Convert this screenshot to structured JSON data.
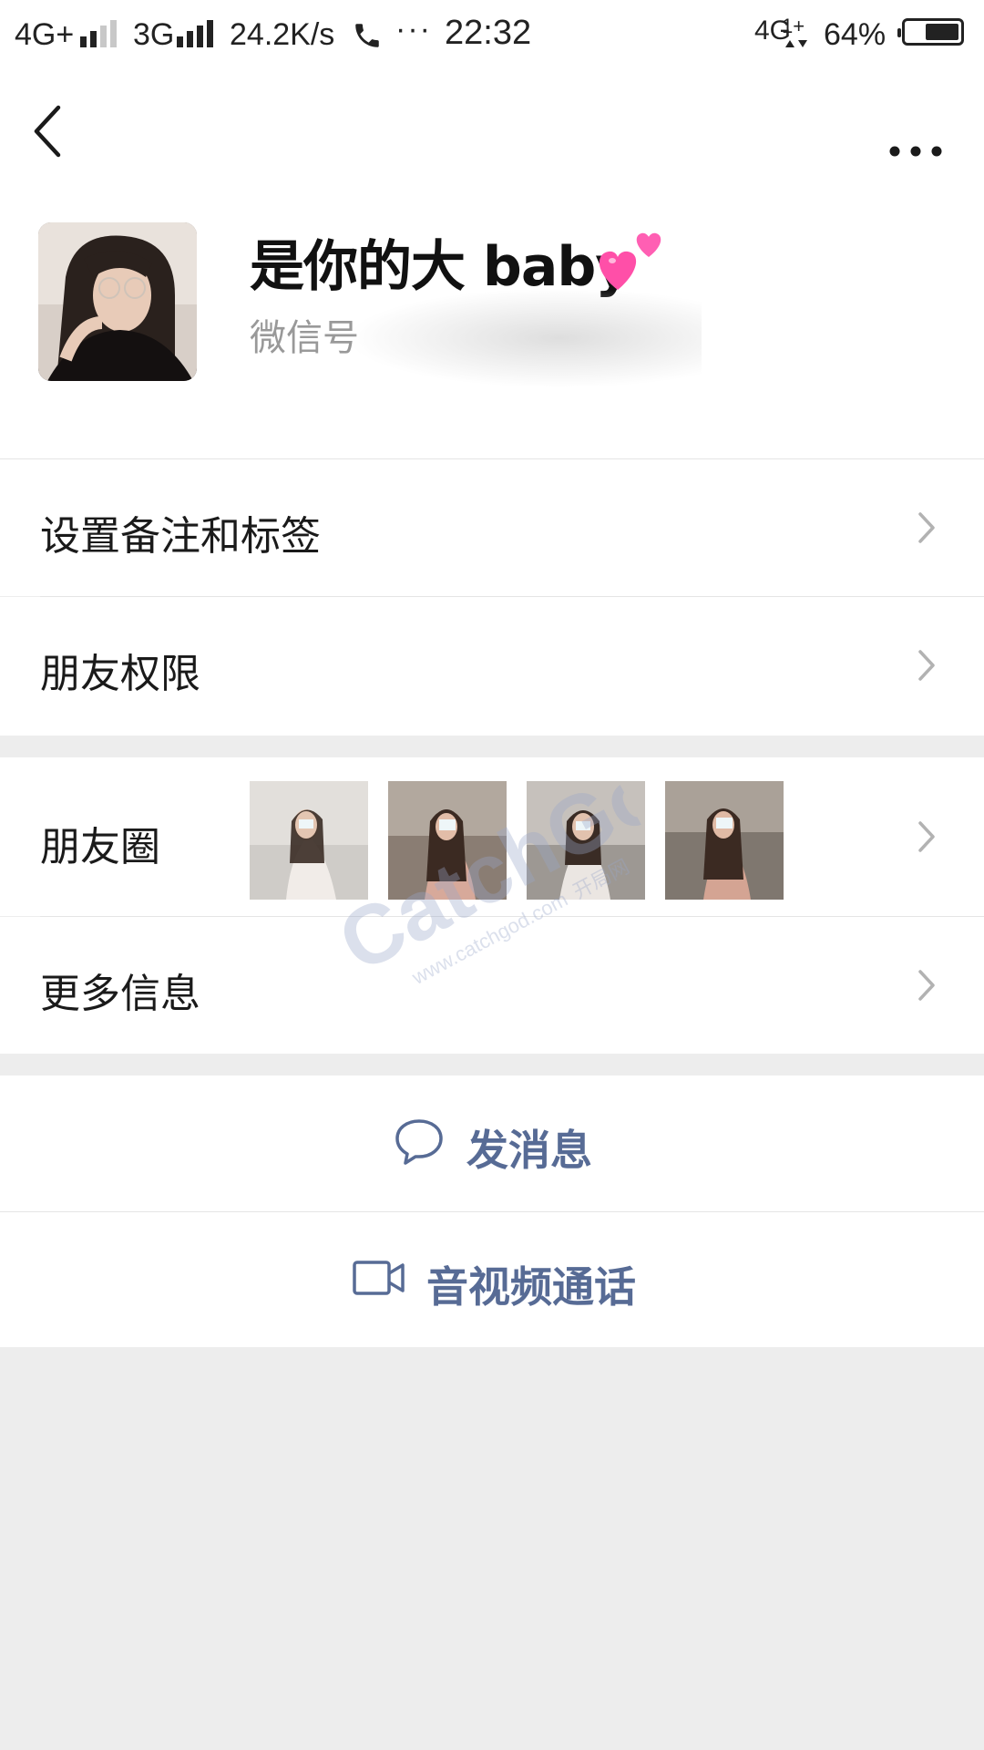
{
  "status_bar": {
    "network1": "4G+",
    "network2": "3G",
    "speed": "24.2K/s",
    "more_glyph": "···",
    "time": "22:32",
    "right_network": "4G",
    "battery_percent": "64%",
    "battery_level": 0.64
  },
  "header": {
    "back_icon": "back-chevron-icon",
    "more_icon": "more-dots-icon"
  },
  "profile": {
    "nickname": "是你的大 baby",
    "wechat_id_label": "微信号"
  },
  "menu": {
    "remarks_tags": "设置备注和标签",
    "friend_permissions": "朋友权限",
    "moments": "朋友圈",
    "more_info": "更多信息"
  },
  "actions": {
    "send_message": "发消息",
    "voice_video_call": "音视频通话"
  },
  "watermark": {
    "brand": "CatchGod",
    "url": "www.catchgod.com",
    "cn": "开局网"
  },
  "colors": {
    "accent": "#576b95",
    "background": "#ededed",
    "cell": "#ffffff",
    "heart": "#ff4fa8"
  }
}
